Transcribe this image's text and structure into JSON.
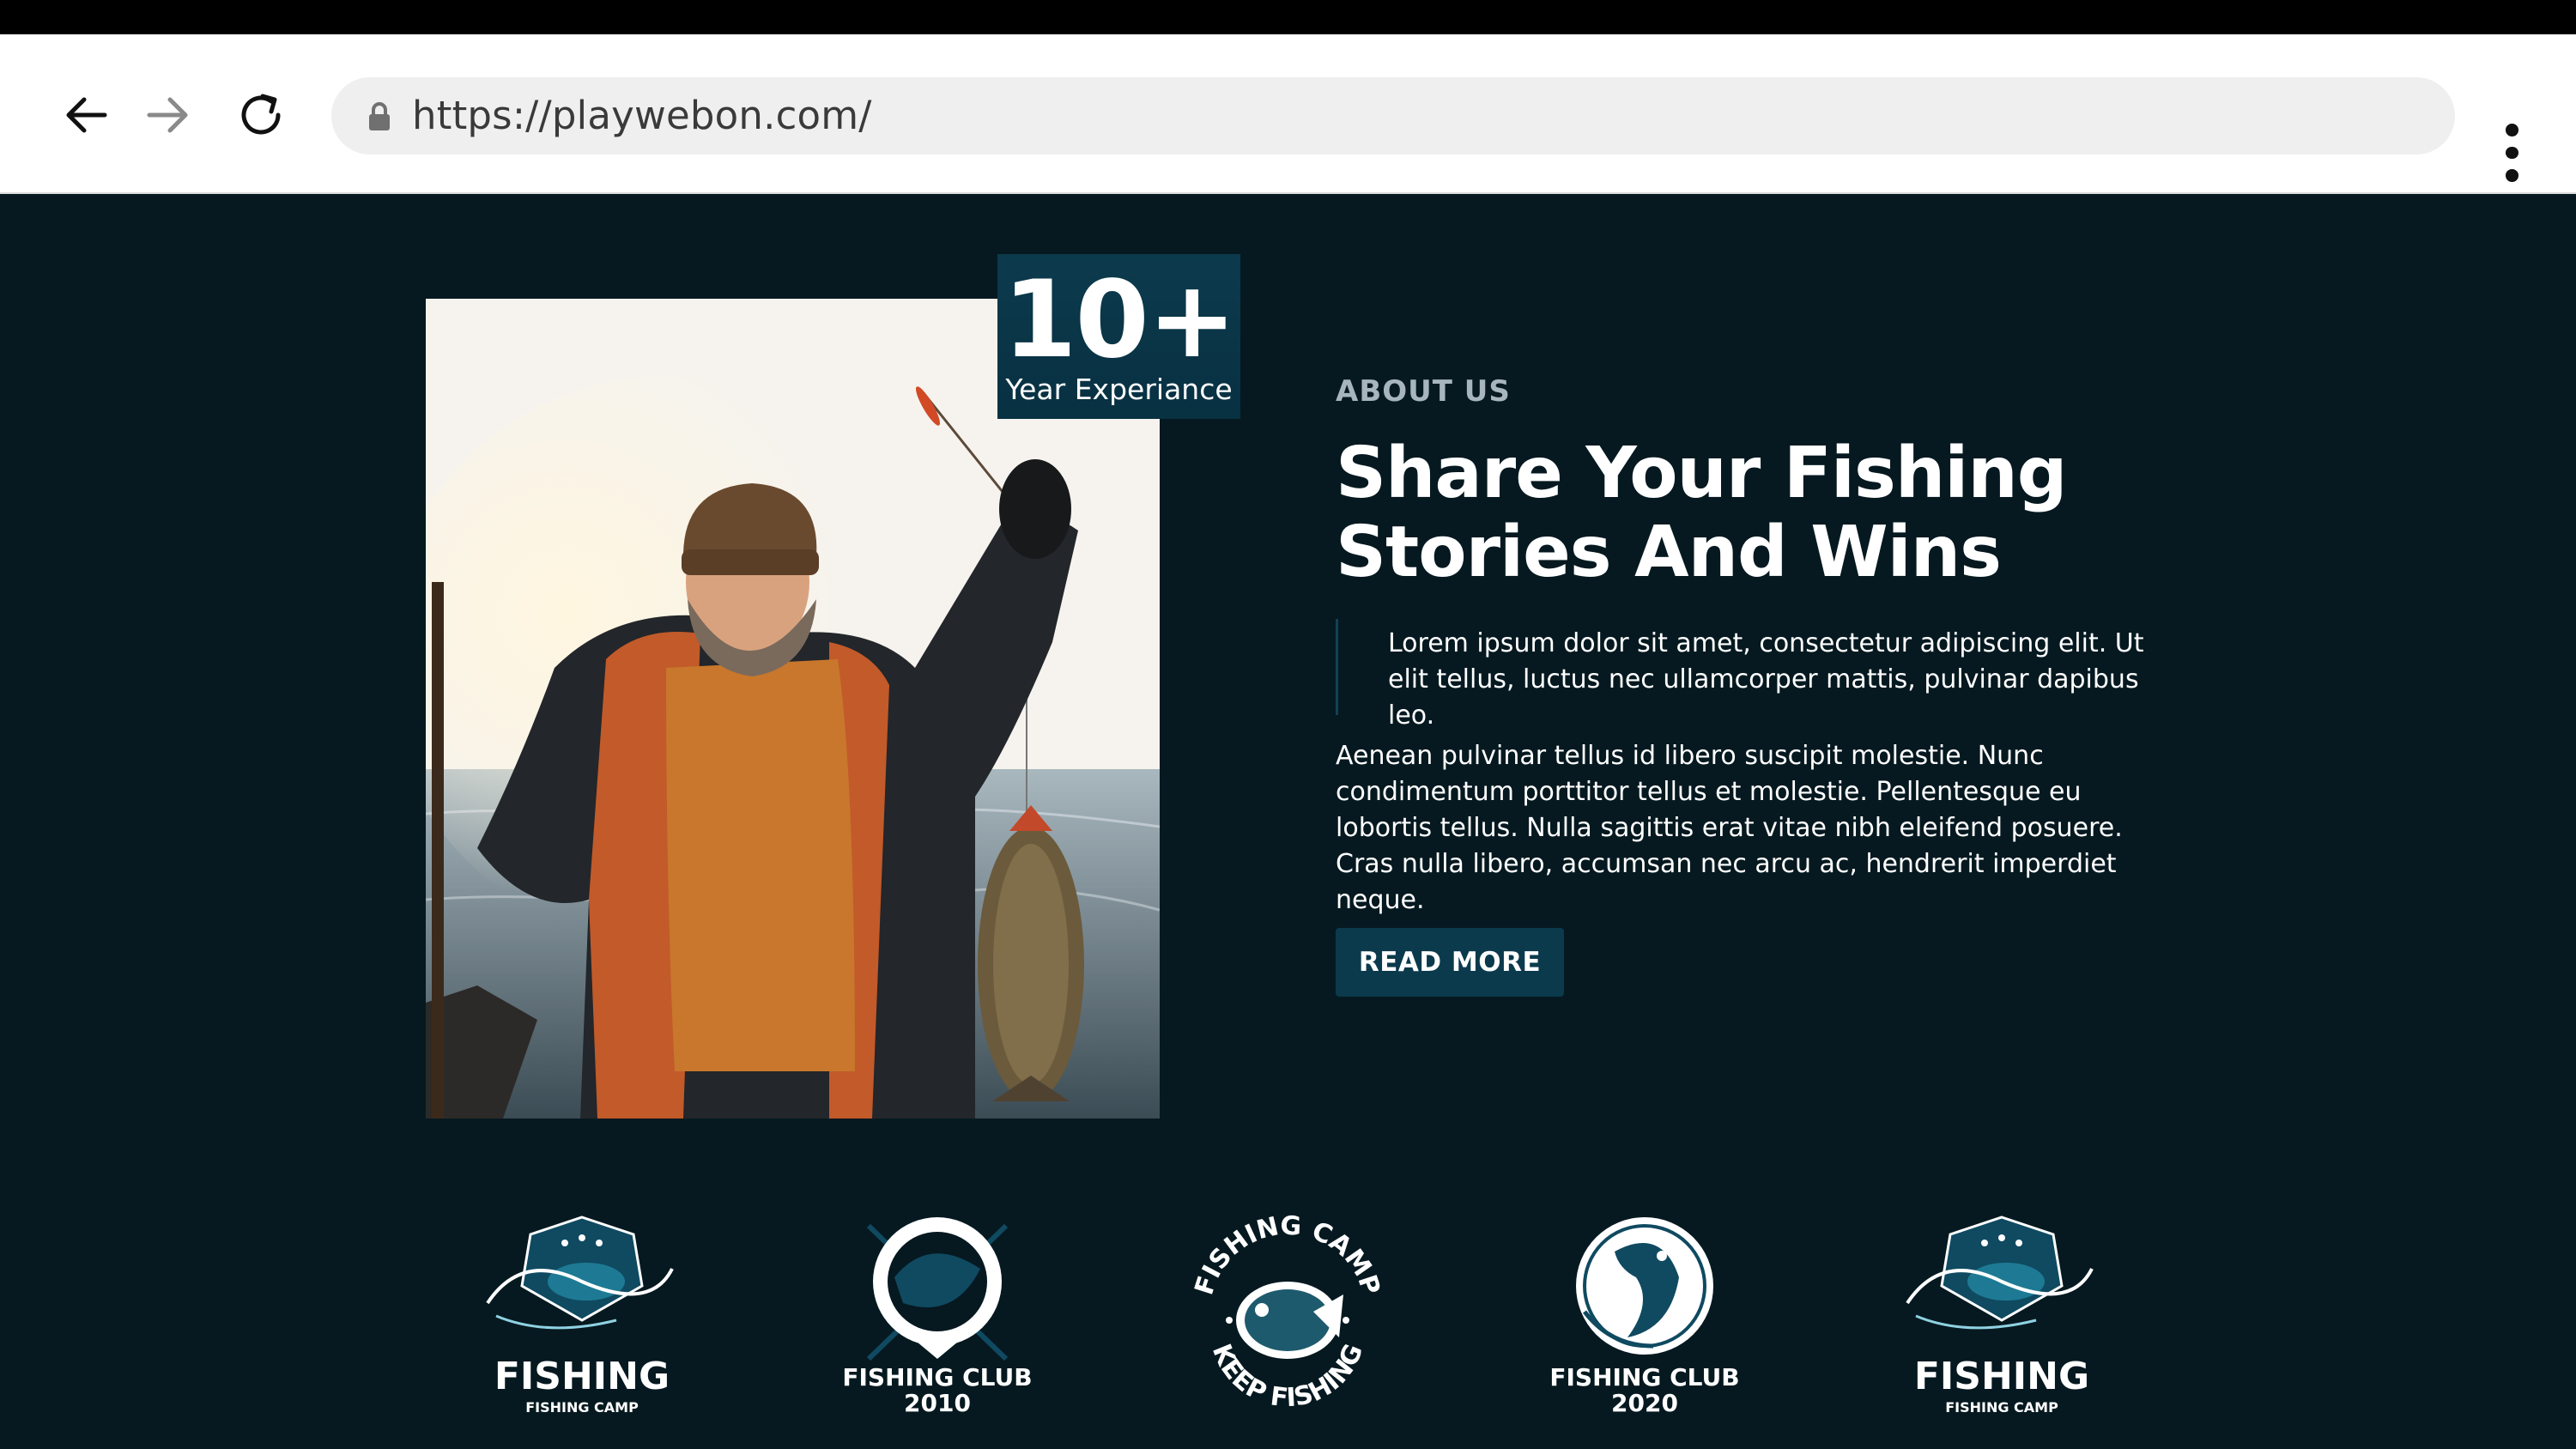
{
  "browser": {
    "url": "https://playwebon.com/"
  },
  "badge": {
    "number": "10+",
    "label": "Year Experiance"
  },
  "about": {
    "eyebrow": "ABOUT US",
    "headline_line1": "Share Your Fishing",
    "headline_line2": "Stories And Wins",
    "quote": "Lorem ipsum dolor sit amet, consectetur adipiscing elit. Ut elit tellus, luctus nec ullamcorper mattis, pulvinar dapibus leo.",
    "body": "Aenean pulvinar tellus id libero suscipit molestie. Nunc condimentum porttitor tellus et molestie. Pellentesque eu lobortis tellus. Nulla sagittis erat vitae nibh eleifend posuere. Cras nulla libero, accumsan nec arcu ac, hendrerit imperdiet neque.",
    "cta": "READ MORE"
  },
  "logos": [
    {
      "title": "FISHING",
      "subtitle": "FISHING CAMP",
      "icon": "fish-hook-emblem-icon"
    },
    {
      "title": "FISHING CLUB",
      "subtitle": "2010",
      "icon": "fish-circle-icon"
    },
    {
      "title_top": "FISHING CAMP",
      "title_bottom": "KEEP FISHING",
      "icon": "bass-fish-badge-icon"
    },
    {
      "title": "FISHING CLUB",
      "subtitle": "2020",
      "icon": "fish-globe-icon"
    },
    {
      "title": "FISHING",
      "subtitle": "FISHING CAMP",
      "icon": "fish-hook-emblem-icon"
    }
  ],
  "colors": {
    "page_background": "#061920",
    "accent": "#0b3a4c",
    "eyebrow": "#a7b5bf"
  }
}
